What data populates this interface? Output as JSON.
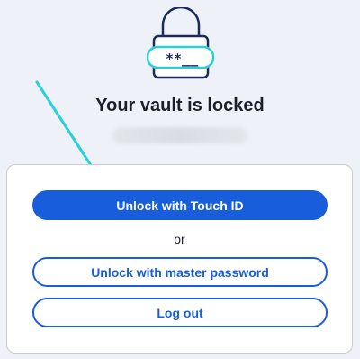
{
  "header": {
    "lock_icon": "lock-with-password-field-icon",
    "password_mask": "**__",
    "title": "Your vault is locked"
  },
  "actions": {
    "touch_id_label": "Unlock with Touch ID",
    "or_text": "or",
    "master_password_label": "Unlock with master password",
    "logout_label": "Log out"
  },
  "colors": {
    "primary": "#175ddc",
    "background": "#eef1f7",
    "annotation_arrow": "#2ad0d6",
    "icon_stroke": "#1a2a5c"
  }
}
